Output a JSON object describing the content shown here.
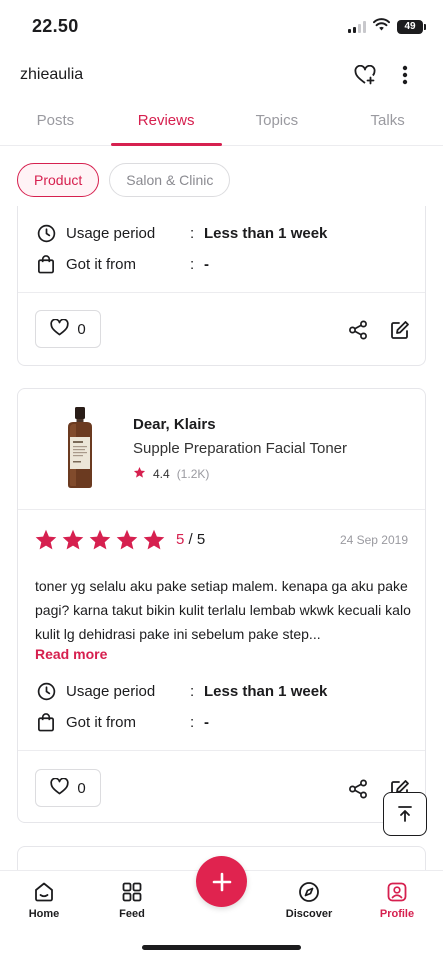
{
  "status_bar": {
    "time": "22.50",
    "battery": "49"
  },
  "header": {
    "username": "zhieaulia"
  },
  "tabs": [
    {
      "label": "Posts"
    },
    {
      "label": "Reviews"
    },
    {
      "label": "Topics"
    },
    {
      "label": "Talks"
    }
  ],
  "filters": [
    {
      "label": "Product"
    },
    {
      "label": "Salon & Clinic"
    }
  ],
  "card_prev": {
    "usage_label": "Usage period",
    "usage_value": "Less than 1 week",
    "source_label": "Got it from",
    "source_value": "-",
    "likes": "0"
  },
  "card_main": {
    "brand": "Dear, Klairs",
    "product": "Supple Preparation Facial Toner",
    "avg_rating": "4.4",
    "rating_count": "(1.2K)",
    "score": "5",
    "score_max": "/ 5",
    "date": "24 Sep 2019",
    "review_text": "toner yg selalu aku pake setiap malem. kenapa ga aku pake pagi? karna takut bikin kulit terlalu lembab wkwk kecuali kalo kulit lg dehidrasi pake ini sebelum pake step...",
    "read_more": "Read more",
    "usage_label": "Usage period",
    "usage_value": "Less than 1 week",
    "source_label": "Got it from",
    "source_value": "-",
    "likes": "0"
  },
  "bottom_nav": [
    {
      "label": "Home"
    },
    {
      "label": "Feed"
    },
    {
      "label": "Discover"
    },
    {
      "label": "Profile"
    }
  ],
  "colors": {
    "accent": "#d6204f",
    "star": "#d6204f",
    "text": "#1c1c1e",
    "muted": "#9a9aa0"
  }
}
